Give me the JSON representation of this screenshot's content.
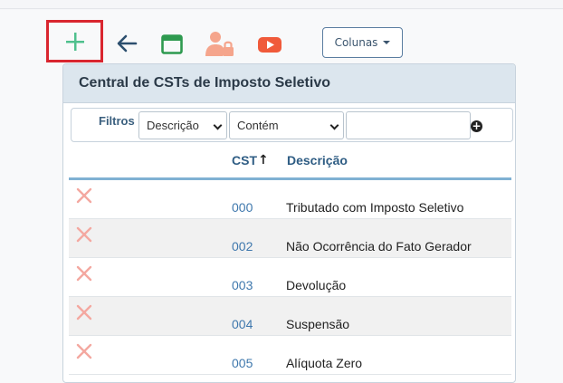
{
  "toolbar": {
    "add_icon": "plus-icon",
    "back_icon": "arrow-left-icon",
    "window_icon": "window-icon",
    "users_icon": "user-lock-icon",
    "video_icon": "youtube-icon",
    "columns_label": "Colunas"
  },
  "card": {
    "title": "Central de CSTs de Imposto Seletivo"
  },
  "filters": {
    "label": "Filtros",
    "field_value": "Descrição",
    "operator_value": "Contém",
    "search_value": ""
  },
  "table": {
    "columns": [
      "CST",
      "Descrição"
    ],
    "sort_indicator": "↑",
    "rows": [
      {
        "cst": "000",
        "descricao": "Tributado com Imposto Seletivo"
      },
      {
        "cst": "002",
        "descricao": "Não Ocorrência do Fato Gerador"
      },
      {
        "cst": "003",
        "descricao": "Devolução"
      },
      {
        "cst": "004",
        "descricao": "Suspensão"
      },
      {
        "cst": "005",
        "descricao": "Alíquota Zero"
      }
    ]
  },
  "colors": {
    "add_green": "#4fc08d",
    "back_blue": "#2c4f6e",
    "window_green": "#2e9a4f",
    "users_salmon": "#f5a58c",
    "video_red": "#f05a3a",
    "delete_red": "#f4a8a0",
    "highlight_red": "#d9262f"
  }
}
